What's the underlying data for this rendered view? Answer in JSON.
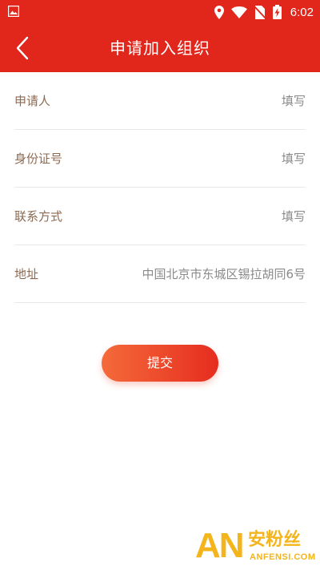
{
  "status_bar": {
    "time": "6:02",
    "icons": [
      "image-icon",
      "location-icon",
      "wifi-icon",
      "no-sim-icon",
      "battery-charging-icon"
    ]
  },
  "header": {
    "title": "申请加入组织",
    "back_icon": "chevron-left-icon"
  },
  "form": {
    "rows": [
      {
        "label": "申请人",
        "value": "填写"
      },
      {
        "label": "身份证号",
        "value": "填写"
      },
      {
        "label": "联系方式",
        "value": "填写"
      },
      {
        "label": "地址",
        "value": "中国北京市东城区锡拉胡同6号"
      }
    ]
  },
  "submit": {
    "label": "提交"
  },
  "watermark": {
    "logo": "AN",
    "brand_cn": "安粉丝",
    "brand_en": "ANFENSI.COM"
  },
  "colors": {
    "brand_red": "#e1261c",
    "label_brown": "#8c6a52",
    "value_gray": "#8a8a8a",
    "button_gradient_start": "#f46a3a",
    "button_gradient_end": "#e62d1f",
    "watermark_gold": "#f3b51b"
  }
}
